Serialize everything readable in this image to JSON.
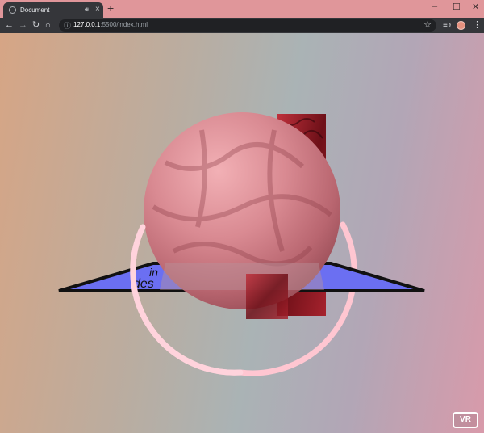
{
  "browser": {
    "tab": {
      "title": "Document",
      "favicon": "globe-icon",
      "audio_icon": "speaker-icon",
      "close_glyph": "×"
    },
    "new_tab_glyph": "+",
    "window_controls": {
      "minimize": "–",
      "maximize": "☐",
      "close": "✕"
    },
    "address": {
      "host": "127.0.0.1",
      "rest": ":5500/index.html"
    },
    "colors": {
      "titlebar": "#e0969a",
      "toolbar": "#35363a"
    }
  },
  "scene": {
    "plane_text_line1": "in",
    "plane_text_line2": "des",
    "colors": {
      "plane": "#6b6ff2",
      "sphere": "#d98a92",
      "ring": "#ffc6d1",
      "box": "#8e1a22"
    }
  },
  "vr_button": {
    "label": "VR"
  }
}
